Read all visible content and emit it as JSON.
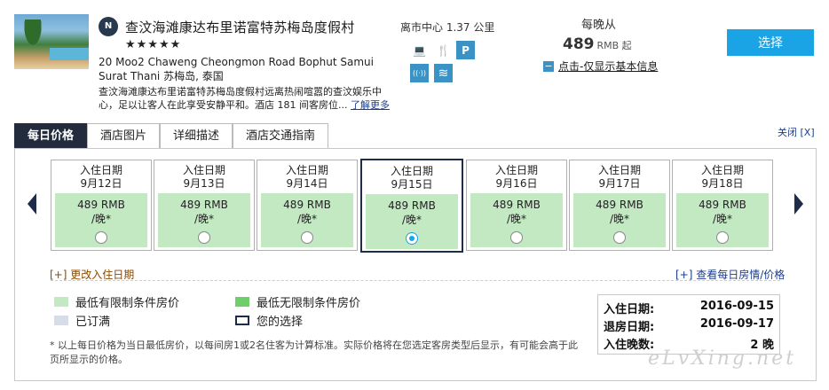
{
  "hotel": {
    "brand_logo_letter": "N",
    "name": "查汶海滩康达布里诺富特苏梅岛度假村",
    "stars": "★★★★★",
    "address": "20 Moo2 Chaweng Cheongmon Road Bophut Samui Surat Thani 苏梅岛, 泰国",
    "description": "查汶海滩康达布里诺富特苏梅岛度假村远离热闹喧嚣的查汶娱乐中心，足以让客人在此享受安静平和。酒店 181 间客房位...",
    "more_link": "了解更多",
    "distance": "离市中心 1.37 公里",
    "amenities": [
      {
        "icon": "laptop-icon",
        "glyph": "💻",
        "style": "plain"
      },
      {
        "icon": "restaurant-icon",
        "glyph": "🍴",
        "style": "plain"
      },
      {
        "icon": "parking-icon",
        "glyph": "P",
        "style": "filled"
      },
      {
        "icon": "wifi-icon",
        "glyph": "((·))",
        "style": "filled"
      },
      {
        "icon": "pool-icon",
        "glyph": "≋",
        "style": "filled"
      }
    ]
  },
  "pricing": {
    "per_night_label": "每晚从",
    "price": "489",
    "price_unit": "RMB 起",
    "basic_info_toggle": "−",
    "basic_info_label": "点击-仅显示基本信息",
    "select_label": "选择"
  },
  "tabs": [
    {
      "label": "每日价格",
      "active": true
    },
    {
      "label": "酒店图片",
      "active": false
    },
    {
      "label": "详细描述",
      "active": false
    },
    {
      "label": "酒店交通指南",
      "active": false
    }
  ],
  "close_label": "关闭 [X]",
  "days": [
    {
      "title": "入住日期",
      "date": "9月12日",
      "price": "489 RMB",
      "per": "/晚*",
      "selected": false
    },
    {
      "title": "入住日期",
      "date": "9月13日",
      "price": "489 RMB",
      "per": "/晚*",
      "selected": false
    },
    {
      "title": "入住日期",
      "date": "9月14日",
      "price": "489 RMB",
      "per": "/晚*",
      "selected": false
    },
    {
      "title": "入住日期",
      "date": "9月15日",
      "price": "489 RMB",
      "per": "/晚*",
      "selected": true
    },
    {
      "title": "入住日期",
      "date": "9月16日",
      "price": "489 RMB",
      "per": "/晚*",
      "selected": false
    },
    {
      "title": "入住日期",
      "date": "9月17日",
      "price": "489 RMB",
      "per": "/晚*",
      "selected": false
    },
    {
      "title": "入住日期",
      "date": "9月18日",
      "price": "489 RMB",
      "per": "/晚*",
      "selected": false
    }
  ],
  "links": {
    "change_date": "[+] 更改入住日期",
    "view_daily": "[+] 查看每日房情/价格"
  },
  "legend": [
    {
      "label": "最低有限制条件房价",
      "color": "#c3e9c3",
      "border": "none"
    },
    {
      "label": "最低无限制条件房价",
      "color": "#6ccf6c",
      "border": "none"
    },
    {
      "label": "已订满",
      "color": "#d6dde6",
      "border": "none"
    },
    {
      "label": "您的选择",
      "color": "#ffffff",
      "border": "#1e2c4a"
    }
  ],
  "footnote": "* 以上每日价格为当日最低房价，以每间房1或2名住客为计算标准。实际价格将在您选定客房类型后显示，有可能会高于此页所显示的价格。",
  "summary": {
    "checkin_label": "入住日期:",
    "checkin_value": "2016-09-15",
    "checkout_label": "退房日期:",
    "checkout_value": "2016-09-17",
    "nights_label": "入住晚数:",
    "nights_value": "2 晚"
  },
  "watermark": "eLvXing.net"
}
